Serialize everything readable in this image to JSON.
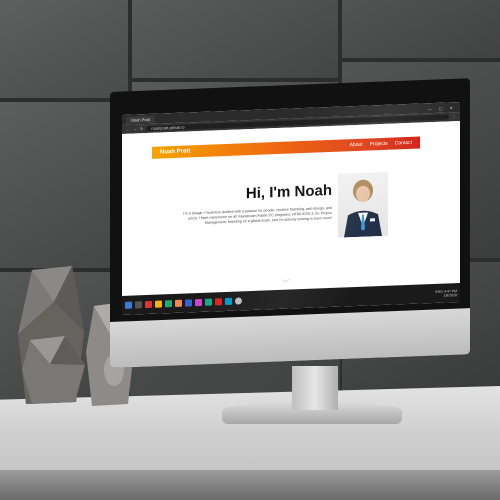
{
  "browser": {
    "tab_title": "Noah Pratt",
    "url": "noahpratt.github.io",
    "window_controls": "—  ▢  ✕"
  },
  "site": {
    "brand": "Noah Pratt",
    "nav": [
      "About",
      "Projects",
      "Contact"
    ],
    "hero_title": "Hi, I'm Noah",
    "hero_text": "I'm a design + business student with a passion for people, creative branding, web design, and pizza. I have experience on all mainstream Adobe CC programs, HTML/CSS & JS, Project Management, branding on a global scale, and I'm actively looking to learn more!",
    "scroll_icon": "chevron-down-icon"
  },
  "taskbar": {
    "time": "4:47 PM",
    "date": "1/8/2020",
    "lang": "ENG"
  },
  "colors": {
    "nav_gradient_start": "#f5a300",
    "nav_gradient_end": "#d22215",
    "taskbar": "#1a1a1a"
  }
}
